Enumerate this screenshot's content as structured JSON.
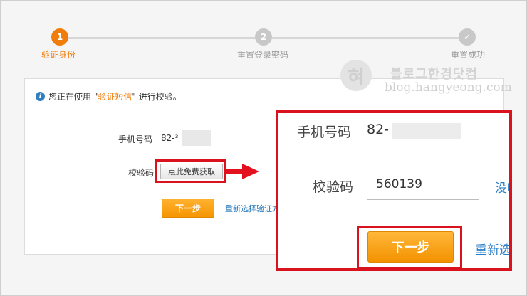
{
  "steps": [
    {
      "number": "1",
      "label": "验证身份"
    },
    {
      "number": "2",
      "label": "重置登录密码"
    },
    {
      "number": "✓",
      "label": "重置成功"
    }
  ],
  "watermark": {
    "seal": "혀",
    "title": "블로그한경닷컴",
    "url": "blog.hangyeong.com"
  },
  "notice": {
    "prefix": "您正在使用 \"",
    "highlight": "验证短信",
    "suffix": "\" 进行校验。"
  },
  "form": {
    "phone_label": "手机号码",
    "phone_value": "82-³",
    "code_label": "校验码",
    "get_code_button": "点此免费获取",
    "next_button": "下一步",
    "reselect_link": "重新选择验证方"
  },
  "zoom": {
    "phone_label": "手机号码",
    "phone_value": "82-",
    "code_label": "校验码",
    "code_value": "560139",
    "no_code_link": "没收",
    "next_button": "下一步",
    "reselect_link": "重新选"
  },
  "colors": {
    "accent": "#f07d0b",
    "highlight_box": "#d9121e",
    "link": "#1a6fb5"
  }
}
